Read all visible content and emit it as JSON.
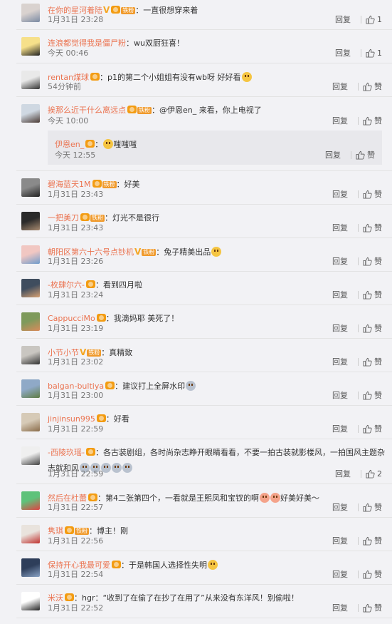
{
  "ui": {
    "reply_label": "回复",
    "like_label": "赞",
    "fan_label": "铁粉"
  },
  "comments": [
    {
      "user": "在你的星河着陆",
      "vip": true,
      "v": true,
      "fan": true,
      "text": "：一直很想穿来着",
      "emoji_after": 0,
      "time": "1月31日 23:28",
      "likes": "1",
      "avatar": [
        "#d9d2cf",
        "#7a8aa3"
      ]
    },
    {
      "user": "连浪都觉得我是僵尸粉",
      "vip": false,
      "v": false,
      "fan": false,
      "text": "：wu双厨狂喜！",
      "emoji_after": 0,
      "time": "今天 00:46",
      "likes": "1",
      "avatar": [
        "#f6e08a",
        "#222"
      ]
    },
    {
      "user": "rentan煤球",
      "vip": true,
      "v": false,
      "fan": false,
      "text": "：p1的第二个小姐姐有没有wb呀 好好看",
      "emoji_after": 1,
      "emoji_kind": "",
      "time": "54分钟前",
      "likes": "赞",
      "avatar": [
        "#e9e9e9",
        "#333"
      ]
    },
    {
      "user": "挨那么近干什么离远点",
      "vip": true,
      "v": false,
      "fan": true,
      "text": "：@伊恩en_ 来看，你上电视了",
      "emoji_after": 0,
      "time": "今天 10:00",
      "likes": "赞",
      "avatar": [
        "#cfd8e2",
        "#4a3a34"
      ]
    },
    {
      "user": "碧海蓝天1M",
      "vip": true,
      "v": false,
      "fan": true,
      "text": "：好美",
      "emoji_after": 0,
      "time": "1月31日 23:43",
      "likes": "赞",
      "avatar": [
        "#8a8a8a",
        "#222"
      ]
    },
    {
      "user": "一把美刀",
      "vip": true,
      "v": false,
      "fan": true,
      "text": "：灯光不是很行",
      "emoji_after": 0,
      "time": "1月31日 23:43",
      "likes": "赞",
      "avatar": [
        "#2a2a2a",
        "#a88a70"
      ]
    },
    {
      "user": "朝阳区第六十六号点钞机",
      "vip": false,
      "v": true,
      "fan": true,
      "text": "：兔子精美出品",
      "emoji_after": 1,
      "emoji_kind": "",
      "time": "1月31日 23:26",
      "likes": "赞",
      "avatar": [
        "#f1c7c2",
        "#6f9ccc"
      ]
    },
    {
      "user": "-枚肆尔六-",
      "vip": true,
      "v": false,
      "fan": false,
      "text": "：看到四月啦",
      "emoji_after": 0,
      "time": "1月31日 23:24",
      "likes": "赞",
      "avatar": [
        "#3f4d5e",
        "#d7a173"
      ]
    },
    {
      "user": "CappucciMo",
      "vip": true,
      "v": false,
      "fan": false,
      "text": "：我滴妈耶 美死了！",
      "emoji_after": 0,
      "time": "1月31日 23:19",
      "likes": "赞",
      "avatar": [
        "#7e9a5b",
        "#d98b5b"
      ]
    },
    {
      "user": "小节小节",
      "vip": false,
      "v": true,
      "fan": true,
      "text": "：真精致",
      "emoji_after": 0,
      "time": "1月31日 23:02",
      "likes": "赞",
      "avatar": [
        "#c9c6c1",
        "#333"
      ]
    },
    {
      "user": "balgan-bultiya",
      "vip": true,
      "v": false,
      "fan": false,
      "text": "：建议打上全屏水印",
      "emoji_after": 1,
      "emoji_kind": "ghost",
      "time": "1月31日 23:00",
      "likes": "赞",
      "avatar": [
        "#8fa9c7",
        "#5f7d45"
      ]
    },
    {
      "user": "jinjinsun995",
      "vip": true,
      "v": false,
      "fan": false,
      "text": "：好看",
      "emoji_after": 0,
      "time": "1月31日 22:59",
      "likes": "赞",
      "avatar": [
        "#d6cab7",
        "#8a6c4a"
      ]
    }
  ],
  "reply": {
    "user": "伊恩en_",
    "vip": true,
    "text": "嗤嗤嗤",
    "time": "今天 12:55",
    "likes": "赞"
  },
  "long_comment": {
    "user": "-西陵玖瑶-",
    "text": "：各古装剧组，各时尚杂志睁开眼睛看看，不要一拍古装就影楼风，一拍国风主题杂志就和风",
    "time": "1月31日 22:59",
    "likes": "2"
  },
  "after_comments": [
    {
      "user": "然后在杜蕾",
      "vip": true,
      "v": false,
      "fan": false,
      "text": "：第4二张第四个，一看就是王熙凤和宝钗的啊",
      "text2": "好美好美～",
      "emoji_after": 2,
      "emoji_kind": "pig",
      "time": "1月31日 22:57",
      "likes": "赞",
      "avatar": [
        "#5ec27a",
        "#e04343"
      ]
    },
    {
      "user": "隽琪",
      "vip": true,
      "v": false,
      "fan": true,
      "text": "：博主！刚",
      "emoji_after": 0,
      "time": "1月31日 22:56",
      "likes": "赞",
      "avatar": [
        "#e9e3dd",
        "#c0322f"
      ]
    },
    {
      "user": "保持开心我最可爱",
      "vip": true,
      "v": false,
      "fan": false,
      "text": "：于是韩国人选择性失明",
      "emoji_after": 1,
      "emoji_kind": "",
      "time": "1月31日 22:54",
      "likes": "赞",
      "avatar": [
        "#2e3e5a",
        "#8aa3c6"
      ]
    },
    {
      "user": "米沃",
      "vip": true,
      "v": false,
      "fan": false,
      "text": "：hgr：“收到了在偷了在抄了在用了”从来没有东洋风！别偷啦！",
      "emoji_after": 0,
      "time": "1月31日 22:52",
      "likes": "赞",
      "avatar": [
        "#ffffff",
        "#222"
      ]
    }
  ]
}
